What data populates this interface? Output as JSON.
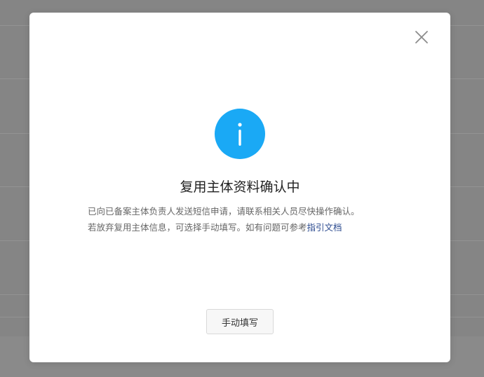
{
  "dialog": {
    "title": "复用主体资料确认中",
    "description_line1": "已向已备案主体负责人发送短信申请，请联系相关人员尽快操作确认。",
    "description_line2_prefix": "若放弃复用主体信息，可选择手动填写。如有问题可参考",
    "guide_link_label": "指引文档",
    "manual_button_label": "手动填写",
    "icons": {
      "close": "close-icon",
      "status": "info-icon"
    },
    "colors": {
      "info_accent": "#1aa9f5",
      "link": "#2b4a8f",
      "overlay": "#8a8a8a"
    }
  }
}
